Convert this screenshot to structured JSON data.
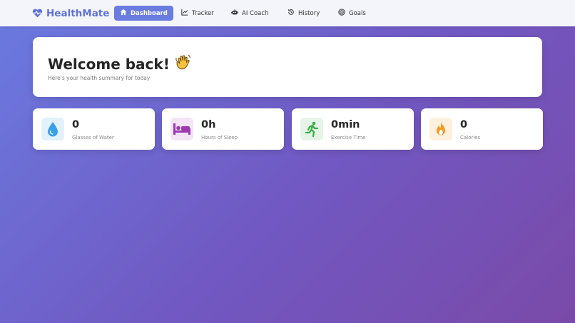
{
  "brand": {
    "name": "HealthMate",
    "color": "#5f72d6"
  },
  "nav": {
    "items": [
      {
        "label": "Dashboard",
        "icon": "home-icon",
        "active": true
      },
      {
        "label": "Tracker",
        "icon": "chart-line-icon",
        "active": false
      },
      {
        "label": "AI Coach",
        "icon": "robot-icon",
        "active": false
      },
      {
        "label": "History",
        "icon": "history-icon",
        "active": false
      },
      {
        "label": "Goals",
        "icon": "target-icon",
        "active": false
      }
    ]
  },
  "welcome": {
    "title": "Welcome back!",
    "emoji": "👋",
    "subtitle": "Here's your health summary for today"
  },
  "stats": [
    {
      "value": "0",
      "label": "Glasses of Water",
      "icon": "water-drop-icon",
      "color": "#3aa0e8"
    },
    {
      "value": "0h",
      "label": "Hours of Sleep",
      "icon": "bed-icon",
      "color": "#9c3bb0"
    },
    {
      "value": "0min",
      "label": "Exercise Time",
      "icon": "running-icon",
      "color": "#3cae4c"
    },
    {
      "value": "0",
      "label": "Calories",
      "icon": "fire-icon",
      "color": "#f39a1e"
    }
  ],
  "colors": {
    "accent": "#6a7ce0"
  }
}
